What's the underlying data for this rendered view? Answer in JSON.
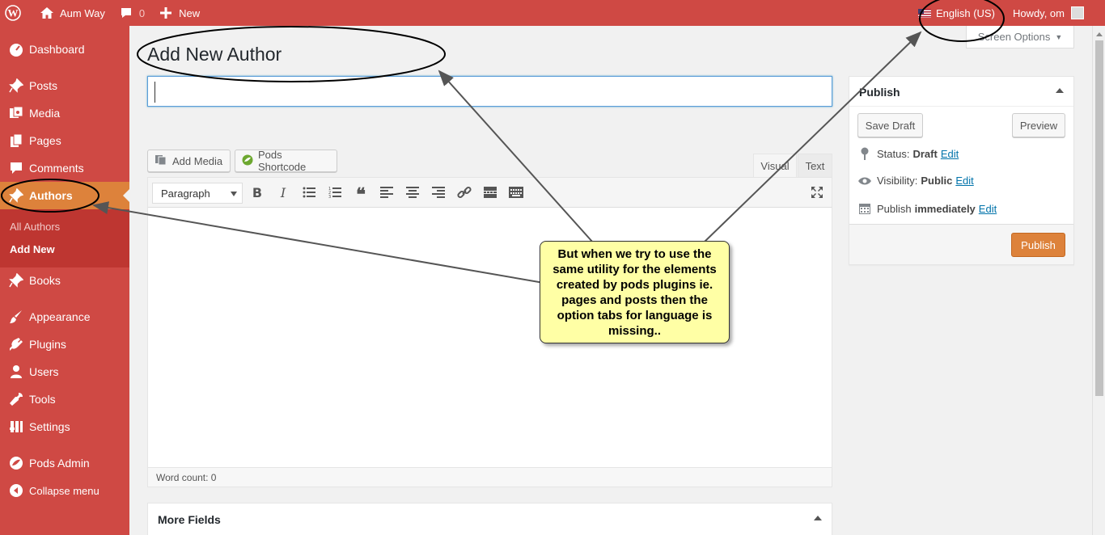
{
  "adminbar": {
    "site_name": "Aum Way",
    "comments_count": "0",
    "new_label": "New",
    "language": "English (US)",
    "howdy": "Howdy, om"
  },
  "sidebar": {
    "items": [
      {
        "label": "Dashboard",
        "icon": "dashboard-icon"
      },
      {
        "label": "Posts",
        "icon": "pin-icon"
      },
      {
        "label": "Media",
        "icon": "media-icon"
      },
      {
        "label": "Pages",
        "icon": "pages-icon"
      },
      {
        "label": "Comments",
        "icon": "comment-icon"
      },
      {
        "label": "Authors",
        "icon": "pin-icon"
      },
      {
        "label": "Books",
        "icon": "pin-icon"
      },
      {
        "label": "Appearance",
        "icon": "brush-icon"
      },
      {
        "label": "Plugins",
        "icon": "plugin-icon"
      },
      {
        "label": "Users",
        "icon": "user-icon"
      },
      {
        "label": "Tools",
        "icon": "wrench-icon"
      },
      {
        "label": "Settings",
        "icon": "settings-icon"
      },
      {
        "label": "Pods Admin",
        "icon": "pods-icon"
      },
      {
        "label": "Collapse menu",
        "icon": "collapse-icon"
      }
    ],
    "submenu": [
      "All Authors",
      "Add New"
    ]
  },
  "main": {
    "screen_options": "Screen Options",
    "page_title": "Add New Author",
    "add_media": "Add Media",
    "pods_shortcode": "Pods Shortcode",
    "tab_visual": "Visual",
    "tab_text": "Text",
    "format_select": "Paragraph",
    "word_count": "Word count: 0",
    "more_fields": "More Fields"
  },
  "publish": {
    "title": "Publish",
    "save_draft": "Save Draft",
    "preview": "Preview",
    "status_label": "Status:",
    "status_value": "Draft",
    "visibility_label": "Visibility:",
    "visibility_value": "Public",
    "publish_label": "Publish",
    "publish_value": "immediately",
    "edit": "Edit",
    "publish_button": "Publish"
  },
  "annotation": {
    "text": "But when we try to use the same utility for the elements created by pods plugins ie. pages and posts then the option tabs for language is missing.."
  },
  "colors": {
    "admin_red": "#cf4944",
    "current_orange": "#dd823b",
    "callout_yellow": "#ffffa5",
    "link_blue": "#0073aa"
  }
}
